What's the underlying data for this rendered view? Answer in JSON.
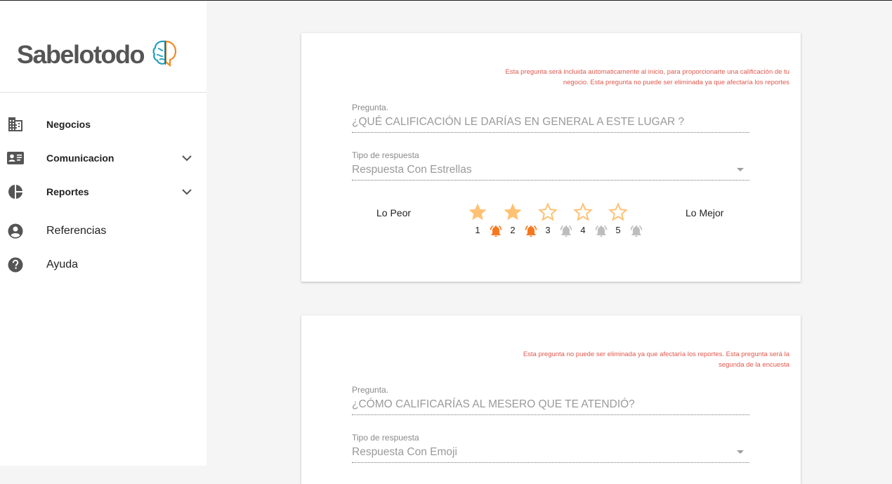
{
  "brand": {
    "name": "Sabelotodo",
    "accent_blue": "#1e9fbf",
    "accent_orange": "#f08a24"
  },
  "sidebar": {
    "items": [
      {
        "label": "Negocios",
        "icon": "business-icon"
      },
      {
        "label": "Comunicacion",
        "icon": "contact-mail-icon"
      },
      {
        "label": "Reportes",
        "icon": "pie-chart-icon"
      },
      {
        "label": "Referencias",
        "icon": "account-circle-icon"
      },
      {
        "label": "Ayuda",
        "icon": "help-icon"
      }
    ]
  },
  "cards": [
    {
      "note": "Esta pregunta será incluida automaticamente al inicio, para proporcionarte una calificación de tu negocio. Esta pregunta no puede ser eliminada ya que afectaría los reportes",
      "question_label": "Pregunta.",
      "question_value": "¿QUÉ CALIFICACIÓN LE DARÍAS EN GENERAL A ESTE LUGAR ?",
      "type_label": "Tipo de respuesta",
      "type_value": "Respuesta Con Estrellas",
      "scale": {
        "worst_label": "Lo Peor",
        "best_label": "Lo Mejor",
        "numbers": [
          "1",
          "2",
          "3",
          "4",
          "5"
        ],
        "filled_stars": 2,
        "active_bells": 2,
        "star_color": "#ffc173",
        "bell_active_color": "#f5781e",
        "bell_inactive_color": "#bdbdbd"
      }
    },
    {
      "note": "Esta pregunta no puede ser eliminada ya que afectaría los reportes. Esta pregunta será la segunda de la encuesta",
      "question_label": "Pregunta.",
      "question_value": "¿CÓMO CALIFICARÍAS AL MESERO QUE TE ATENDIÓ?",
      "type_label": "Tipo de respuesta",
      "type_value": "Respuesta Con Emoji"
    }
  ]
}
